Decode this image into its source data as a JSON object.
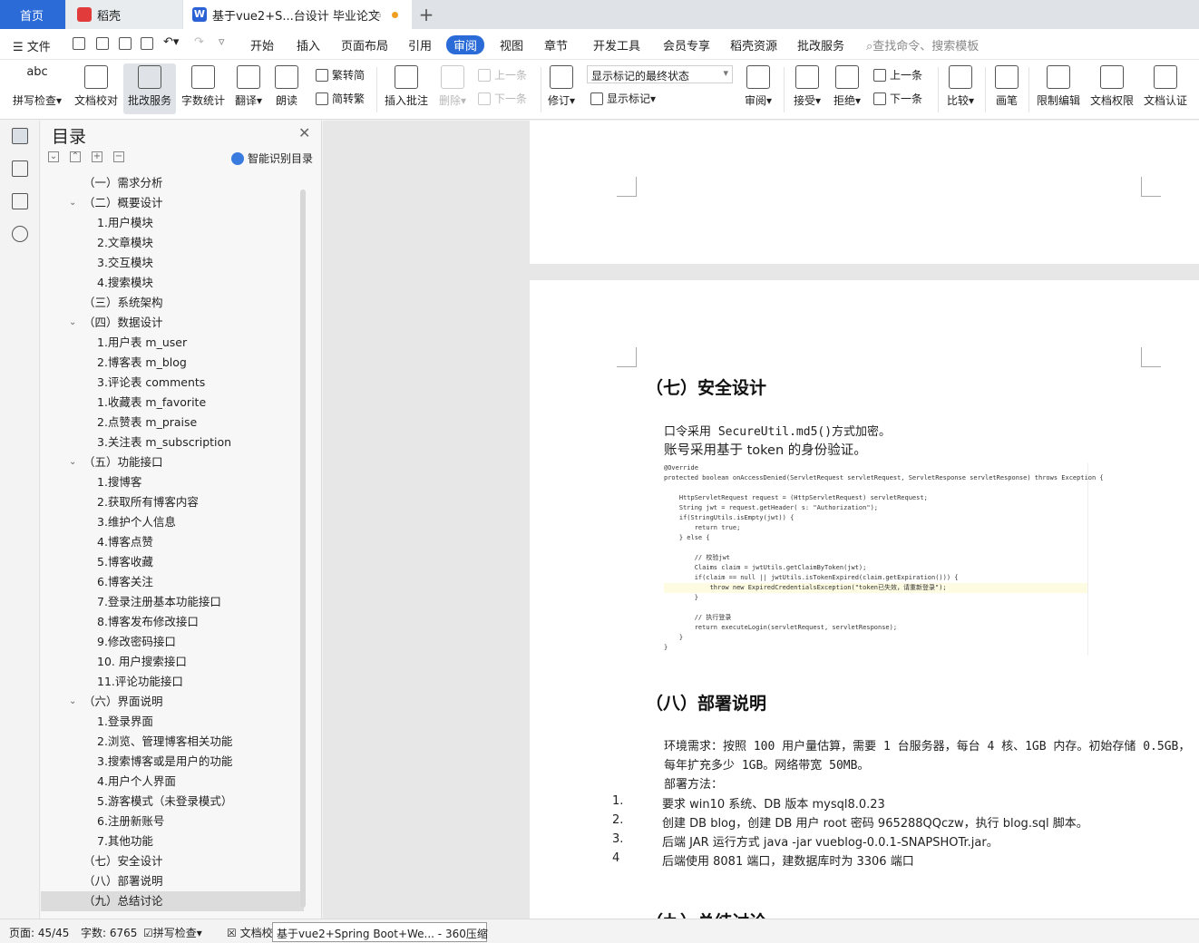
{
  "tabs": {
    "home": "首页",
    "daoke": "稻壳",
    "doc": "基于vue2+S...台设计 毕业论文"
  },
  "menu": {
    "file": "文件",
    "items": [
      "开始",
      "插入",
      "页面布局",
      "引用",
      "审阅",
      "视图",
      "章节",
      "开发工具",
      "会员专享",
      "稻壳资源",
      "批改服务"
    ],
    "active": "审阅",
    "search": "查找命令、搜索模板"
  },
  "ribbon": {
    "spell": "拼写检查",
    "doc_check": "文档校对",
    "revise_service": "批改服务",
    "word_count": "字数统计",
    "translate": "翻译",
    "read_aloud": "朗读",
    "to_traditional": "繁转简",
    "to_simplified": "简转繁",
    "insert_comment": "插入批注",
    "delete": "删除",
    "prev": "上一条",
    "next": "下一条",
    "track": "修订",
    "markup_select": "显示标记的最终状态",
    "show_markup": "显示标记",
    "review": "审阅",
    "accept": "接受",
    "reject": "拒绝",
    "prev2": "上一条",
    "next2": "下一条",
    "compare": "比较",
    "pen": "画笔",
    "restrict": "限制编辑",
    "doc_perm": "文档权限",
    "doc_cert": "文档认证"
  },
  "toc": {
    "title": "目录",
    "smart": "智能识别目录",
    "items": [
      {
        "text": "（一）需求分析",
        "level": 1,
        "caret": false
      },
      {
        "text": "（二）概要设计",
        "level": 1,
        "caret": true
      },
      {
        "text": "1.用户模块",
        "level": 2
      },
      {
        "text": "2.文章模块",
        "level": 2
      },
      {
        "text": "3.交互模块",
        "level": 2
      },
      {
        "text": "4.搜索模块",
        "level": 2
      },
      {
        "text": "（三）系统架构",
        "level": 1,
        "caret": false
      },
      {
        "text": "（四）数据设计",
        "level": 1,
        "caret": true
      },
      {
        "text": "1.用户表 m_user",
        "level": 2
      },
      {
        "text": "2.博客表 m_blog",
        "level": 2
      },
      {
        "text": "3.评论表 comments",
        "level": 2
      },
      {
        "text": "1.收藏表 m_favorite",
        "level": 2
      },
      {
        "text": "2.点赞表 m_praise",
        "level": 2
      },
      {
        "text": "3.关注表 m_subscription",
        "level": 2
      },
      {
        "text": "（五）功能接口",
        "level": 1,
        "caret": true
      },
      {
        "text": "1.搜博客",
        "level": 2
      },
      {
        "text": "2.获取所有博客内容",
        "level": 2
      },
      {
        "text": "3.维护个人信息",
        "level": 2
      },
      {
        "text": "4.博客点赞",
        "level": 2
      },
      {
        "text": "5.博客收藏",
        "level": 2
      },
      {
        "text": "6.博客关注",
        "level": 2
      },
      {
        "text": "7.登录注册基本功能接口",
        "level": 2
      },
      {
        "text": "8.博客发布修改接口",
        "level": 2
      },
      {
        "text": "9.修改密码接口",
        "level": 2
      },
      {
        "text": "10.  用户搜索接口",
        "level": 2
      },
      {
        "text": "11.评论功能接口",
        "level": 2
      },
      {
        "text": "（六）界面说明",
        "level": 1,
        "caret": true
      },
      {
        "text": "1.登录界面",
        "level": 2
      },
      {
        "text": "2.浏览、管理博客相关功能",
        "level": 2
      },
      {
        "text": "3.搜索博客或是用户的功能",
        "level": 2
      },
      {
        "text": "4.用户个人界面",
        "level": 2
      },
      {
        "text": "5.游客模式（未登录模式）",
        "level": 2
      },
      {
        "text": "6.注册新账号",
        "level": 2
      },
      {
        "text": "7.其他功能",
        "level": 2
      },
      {
        "text": "（七）安全设计",
        "level": 1,
        "caret": false
      },
      {
        "text": "（八）部署说明",
        "level": 1,
        "caret": false
      },
      {
        "text": "（九）总结讨论",
        "level": 1,
        "caret": false,
        "selected": true
      }
    ]
  },
  "doc": {
    "h_security": "（七）安全设计",
    "security_l1": "口令采用 SecureUtil.md5()方式加密。",
    "security_l2": "账号采用基于 token 的身份验证。",
    "code": [
      "@Override",
      "protected boolean onAccessDenied(ServletRequest servletRequest, ServletResponse servletResponse) throws Exception {",
      "",
      "    HttpServletRequest request = (HttpServletRequest) servletRequest;",
      "    String jwt = request.getHeader( s: \"Authorization\");",
      "    if(StringUtils.isEmpty(jwt)) {",
      "        return true;",
      "    } else {",
      "",
      "        // 校验jwt",
      "        Claims claim = jwtUtils.getClaimByToken(jwt);",
      "        if(claim == null || jwtUtils.isTokenExpired(claim.getExpiration())) {",
      "            throw new ExpiredCredentialsException(\"token已失效，请重新登录\");",
      "        }",
      "",
      "        // 执行登录",
      "        return executeLogin(servletRequest, servletResponse);",
      "    }",
      "}"
    ],
    "h_deploy": "（八）部署说明",
    "deploy_env_1": "环境需求：按照 100 用户量估算，需要 1 台服务器，每台 4 核、1GB 内存。初始存储 0.5GB，",
    "deploy_env_2": "每年扩充多少 1GB。网络带宽 50MB。",
    "deploy_method": "部署方法：",
    "steps": [
      {
        "n": "1.",
        "t": "要求 win10 系统、DB 版本 mysql8.0.23"
      },
      {
        "n": "2.",
        "t": "创建 DB blog，创建 DB 用户 root  密码 965288QQczw，执行 blog.sql 脚本。"
      },
      {
        "n": "3.",
        "t": "后端 JAR 运行方式 java -jar vueblog-0.0.1-SNAPSHOTr.jar。"
      },
      {
        "n": "4",
        "t": "后端使用 8081 端口，建数据库时为 3306 端口"
      }
    ],
    "h_summary": "（九）总结讨论"
  },
  "status": {
    "page": "页面: 45/45",
    "words": "字数: 6765",
    "spell": "拼写检查",
    "doccheck": "文档校",
    "tooltip": "基于vue2+Spring Boot+We... - 360压缩"
  }
}
